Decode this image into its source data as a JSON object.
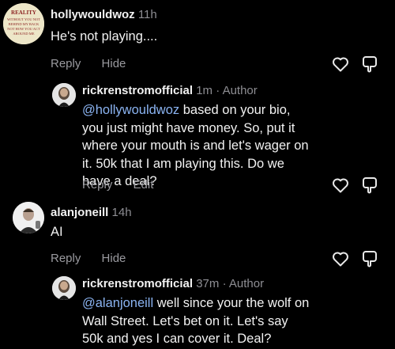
{
  "comments": [
    {
      "username": "hollywouldwoz",
      "time": "11h",
      "text": "He's not playing....",
      "actions": [
        "Reply",
        "Hide"
      ],
      "avatar_text": "REALITY\nWITHOUT YOU NOT\nBEHIND MY BACK\nNOT HOW YOU ACT\nAROUND ME"
    },
    {
      "username": "rickrenstromofficial",
      "time": "1m",
      "badge": "Author",
      "mention": "@hollywouldwoz",
      "text": " based on your bio, you just might have money. So, put it where your mouth is and let's wager on it. 50k that I am playing this. Do we have a deal?",
      "actions": [
        "Reply",
        "Edit"
      ]
    },
    {
      "username": "alanjoneill",
      "time": "14h",
      "text": "AI",
      "actions": [
        "Reply",
        "Hide"
      ]
    },
    {
      "username": "rickrenstromofficial",
      "time": "37m",
      "badge": "Author",
      "mention": "@alanjoneill",
      "text": " well since your the wolf on Wall Street. Let's bet on it. Let's say 50k and yes I can cover it. Deal?"
    }
  ],
  "separator": " · ",
  "colors": {
    "background": "#000000",
    "mention": "#8bb4f2",
    "meta": "#8e8e93"
  },
  "icons": [
    "heart-icon",
    "dislike-icon"
  ]
}
